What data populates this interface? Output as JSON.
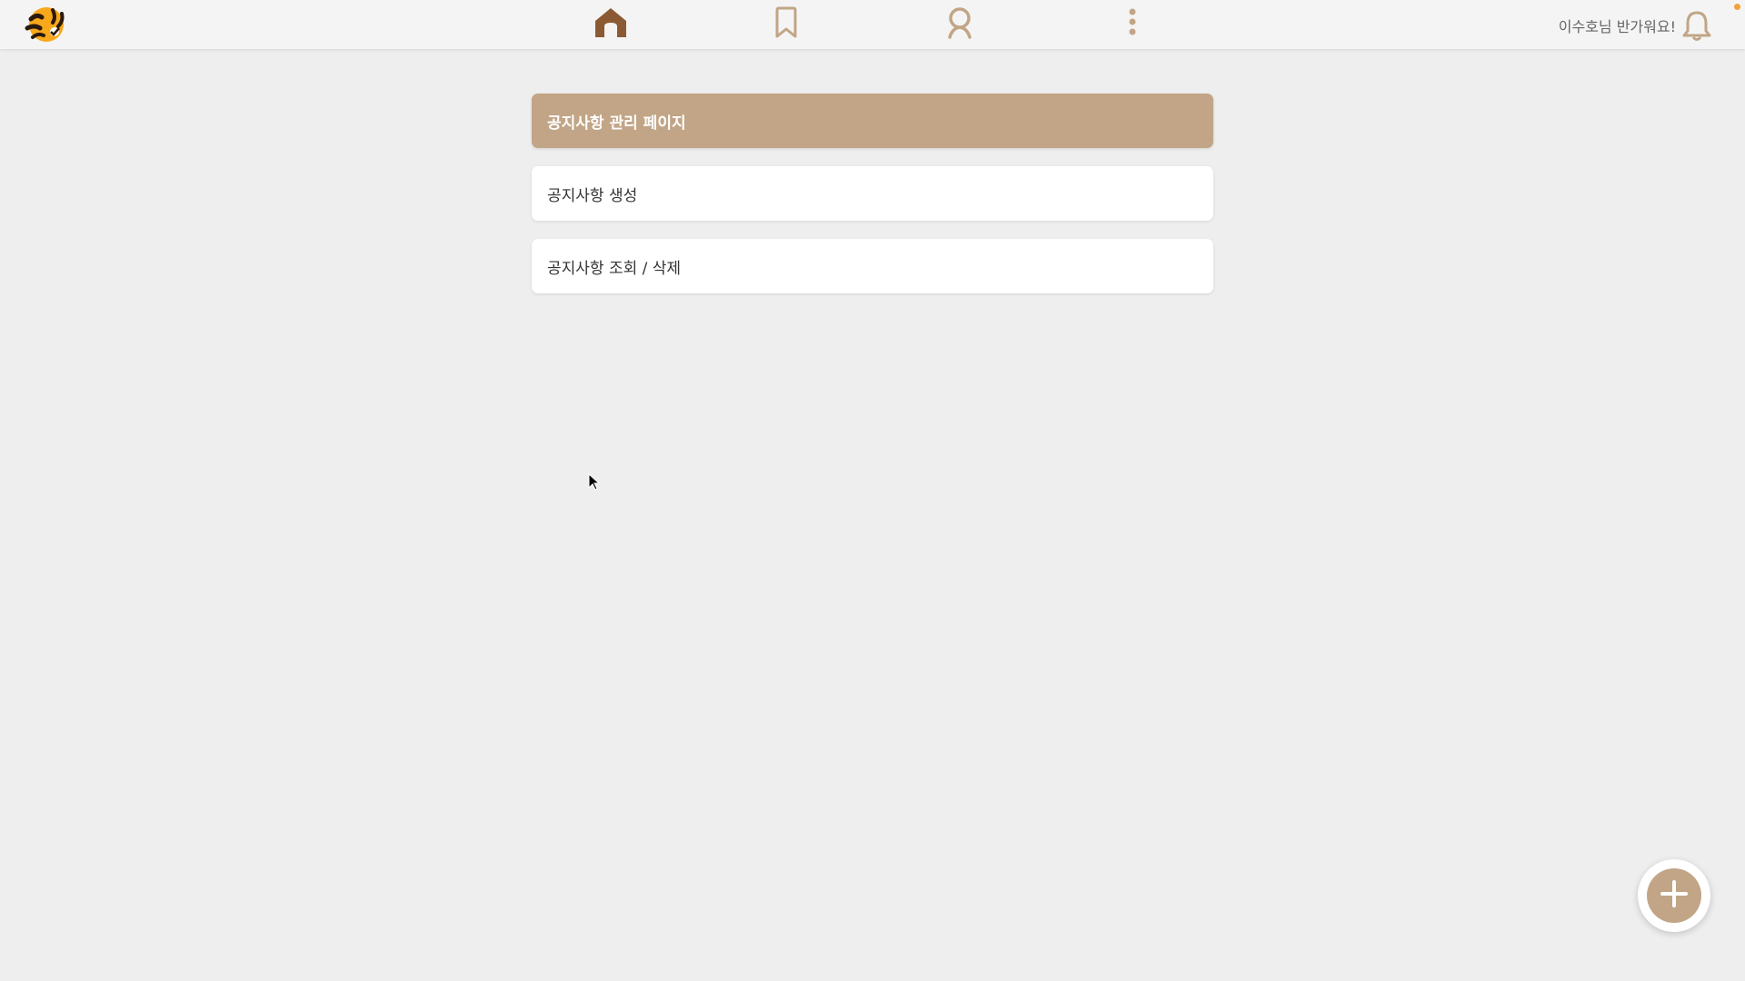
{
  "app": {
    "logo_icon": "tiger-logo-icon",
    "accent_color": "#c1a586",
    "active_icon_color": "#8b5a32",
    "inactive_icon_color": "#c1a586"
  },
  "nav": {
    "items": [
      {
        "icon": "home-icon",
        "active": true
      },
      {
        "icon": "bookmark-icon",
        "active": false
      },
      {
        "icon": "profile-icon",
        "active": false
      },
      {
        "icon": "more-vertical-icon",
        "active": false
      }
    ]
  },
  "user": {
    "greeting": "이수호님 반가워요!",
    "notification_icon": "bell-icon",
    "has_notification": true
  },
  "page": {
    "title": "공지사항 관리 페이지",
    "menu": [
      {
        "label": "공지사항 생성"
      },
      {
        "label": "공지사항 조회 / 삭제"
      }
    ]
  },
  "fab": {
    "icon": "plus-icon"
  }
}
